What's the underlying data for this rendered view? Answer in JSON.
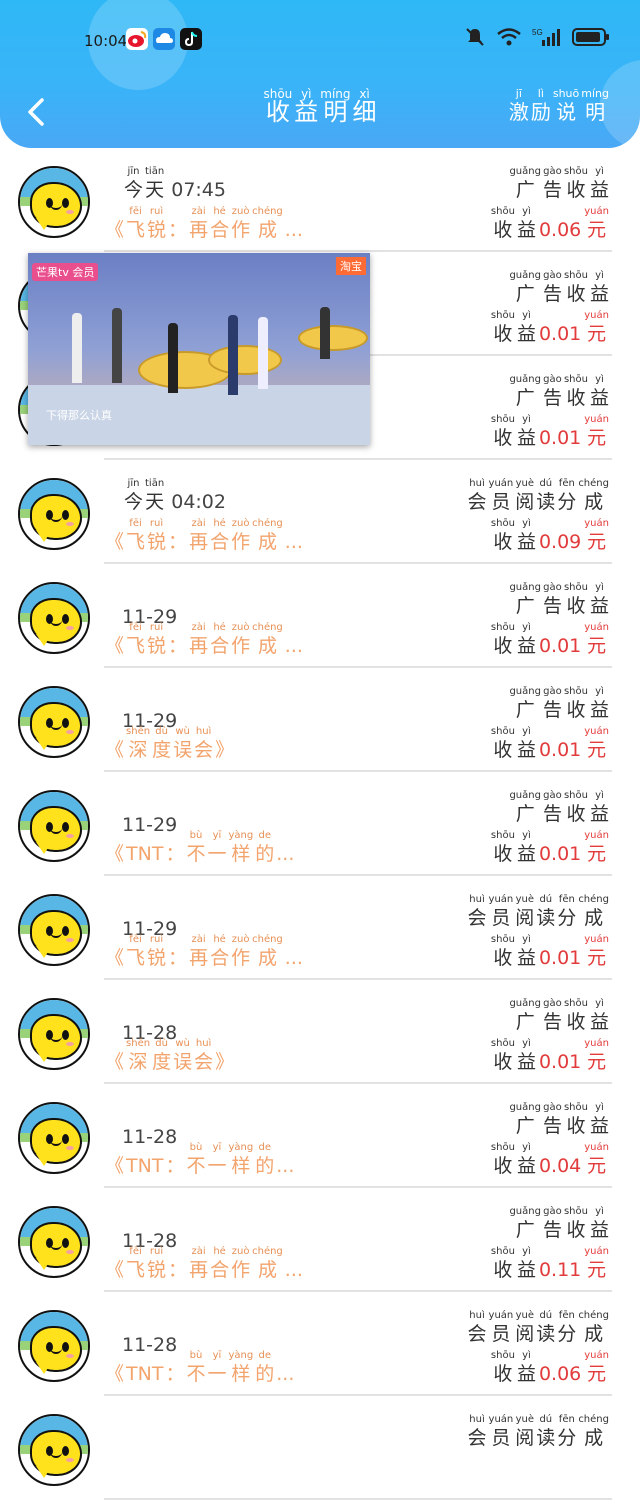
{
  "status_bar": {
    "time": "10:04",
    "icons_left": [
      "weibo-icon",
      "cloud-icon",
      "tiktok-icon"
    ],
    "icons_right": [
      "mute-icon",
      "wifi-icon",
      "5g-signal-icon",
      "battery-icon"
    ]
  },
  "header": {
    "title": [
      {
        "h": "收",
        "p": "shōu"
      },
      {
        "h": "益",
        "p": "yì"
      },
      {
        "h": "明",
        "p": "míng"
      },
      {
        "h": "细",
        "p": "xì"
      }
    ],
    "right_link": [
      {
        "h": "激",
        "p": "jī"
      },
      {
        "h": "励",
        "p": "lì"
      },
      {
        "h": "说",
        "p": "shuō"
      },
      {
        "h": "明",
        "p": "míng"
      }
    ]
  },
  "labels": {
    "today": [
      {
        "h": "今",
        "p": "jīn"
      },
      {
        "h": "天",
        "p": "tiān"
      }
    ],
    "income": [
      {
        "h": "收",
        "p": "shōu"
      },
      {
        "h": "益",
        "p": "yì"
      }
    ],
    "yuan": {
      "h": "元",
      "p": "yuán"
    },
    "ad_income": [
      {
        "h": "广",
        "p": "guǎng"
      },
      {
        "h": "告",
        "p": "gào"
      },
      {
        "h": "收",
        "p": "shōu"
      },
      {
        "h": "益",
        "p": "yì"
      }
    ],
    "member_share": [
      {
        "h": "会",
        "p": "huì"
      },
      {
        "h": "员",
        "p": "yuán"
      },
      {
        "h": "阅",
        "p": "yuè"
      },
      {
        "h": "读",
        "p": "dú"
      },
      {
        "h": "分",
        "p": "fēn"
      },
      {
        "h": "成",
        "p": "chéng"
      }
    ]
  },
  "books": {
    "feirui": [
      {
        "h": "《",
        "p": ""
      },
      {
        "h": "飞",
        "p": "fēi"
      },
      {
        "h": "锐",
        "p": "ruì"
      },
      {
        "h": "：",
        "p": ""
      },
      {
        "h": "再",
        "p": "zài"
      },
      {
        "h": "合",
        "p": "hé"
      },
      {
        "h": "作",
        "p": "zuò"
      },
      {
        "h": "成",
        "p": "chéng"
      },
      {
        "h": "...",
        "p": ""
      }
    ],
    "shendu": [
      {
        "h": "《",
        "p": ""
      },
      {
        "h": "深",
        "p": "shēn"
      },
      {
        "h": "度",
        "p": "dù"
      },
      {
        "h": "误",
        "p": "wù"
      },
      {
        "h": "会",
        "p": "huì"
      },
      {
        "h": "》",
        "p": ""
      }
    ],
    "tnt": [
      {
        "h": "《",
        "p": ""
      },
      {
        "h": "TNT",
        "p": ""
      },
      {
        "h": "：",
        "p": ""
      },
      {
        "h": "不",
        "p": "bù"
      },
      {
        "h": "一",
        "p": "yī"
      },
      {
        "h": "样",
        "p": "yàng"
      },
      {
        "h": "的",
        "p": "de"
      },
      {
        "h": "...",
        "p": ""
      }
    ]
  },
  "rows": [
    {
      "today": true,
      "time": "07:45",
      "date": "",
      "book": "feirui",
      "type": "ad_income",
      "amount": "0.06"
    },
    {
      "today": false,
      "time": "",
      "date": "",
      "book": "",
      "type": "ad_income",
      "amount": "0.01"
    },
    {
      "today": false,
      "time": "",
      "date": "",
      "book": "",
      "type": "ad_income",
      "amount": "0.01"
    },
    {
      "today": true,
      "time": "04:02",
      "date": "",
      "book": "feirui",
      "type": "member_share",
      "amount": "0.09"
    },
    {
      "today": false,
      "time": "",
      "date": "11-29",
      "book": "feirui",
      "type": "ad_income",
      "amount": "0.01"
    },
    {
      "today": false,
      "time": "",
      "date": "11-29",
      "book": "shendu",
      "type": "ad_income",
      "amount": "0.01"
    },
    {
      "today": false,
      "time": "",
      "date": "11-29",
      "book": "tnt",
      "type": "ad_income",
      "amount": "0.01"
    },
    {
      "today": false,
      "time": "",
      "date": "11-29",
      "book": "feirui",
      "type": "member_share",
      "amount": "0.01"
    },
    {
      "today": false,
      "time": "",
      "date": "11-28",
      "book": "shendu",
      "type": "ad_income",
      "amount": "0.01"
    },
    {
      "today": false,
      "time": "",
      "date": "11-28",
      "book": "tnt",
      "type": "ad_income",
      "amount": "0.04"
    },
    {
      "today": false,
      "time": "",
      "date": "11-28",
      "book": "feirui",
      "type": "ad_income",
      "amount": "0.11"
    },
    {
      "today": false,
      "time": "",
      "date": "11-28",
      "book": "tnt",
      "type": "member_share",
      "amount": "0.06"
    },
    {
      "today": false,
      "time": "",
      "date": "",
      "book": "",
      "type": "member_share",
      "amount": ""
    }
  ],
  "video_overlay": {
    "channel": "芒果tv 会员",
    "corner_tag": "淘宝",
    "subtitle": "下得那么认真"
  },
  "colors": {
    "header_blue": "#36b4f7",
    "amount_red": "#e23b3b",
    "book_orange": "#f3a46d"
  }
}
